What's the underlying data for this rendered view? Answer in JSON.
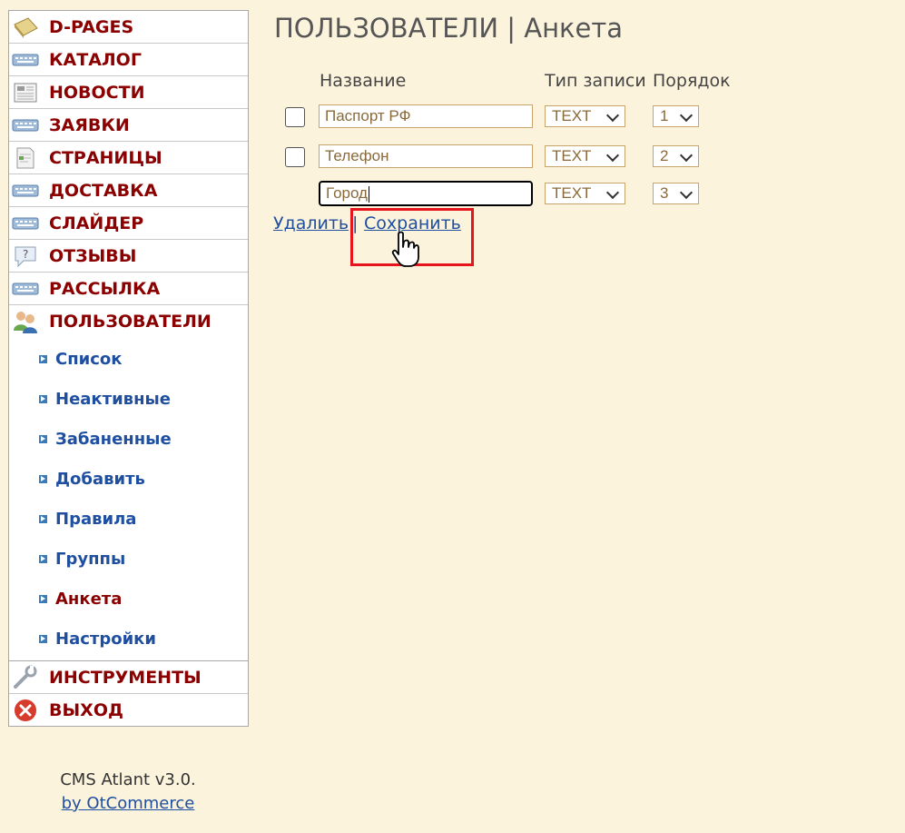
{
  "sidebar": {
    "items": [
      {
        "label": "D-PAGES",
        "icon": "book-icon"
      },
      {
        "label": "КАТАЛОГ",
        "icon": "keyboard-icon"
      },
      {
        "label": "НОВОСТИ",
        "icon": "newspaper-icon"
      },
      {
        "label": "ЗАЯВКИ",
        "icon": "keyboard-icon"
      },
      {
        "label": "СТРАНИЦЫ",
        "icon": "page-icon"
      },
      {
        "label": "ДОСТАВКА",
        "icon": "keyboard-icon"
      },
      {
        "label": "СЛАЙДЕР",
        "icon": "keyboard-icon"
      },
      {
        "label": "ОТЗЫВЫ",
        "icon": "question-bubble-icon"
      },
      {
        "label": "РАССЫЛКА",
        "icon": "keyboard-icon"
      },
      {
        "label": "ПОЛЬЗОВАТЕЛИ",
        "icon": "users-icon"
      }
    ],
    "subitems": [
      {
        "label": "Список"
      },
      {
        "label": "Неактивные"
      },
      {
        "label": "Забаненные"
      },
      {
        "label": "Добавить"
      },
      {
        "label": "Правила"
      },
      {
        "label": "Группы"
      },
      {
        "label": "Анкета",
        "active": true
      },
      {
        "label": "Настройки"
      }
    ],
    "bottom_items": [
      {
        "label": "ИНСТРУМЕНТЫ",
        "icon": "wrench-icon"
      },
      {
        "label": "ВЫХОД",
        "icon": "exit-icon"
      }
    ]
  },
  "footer": {
    "line1": "CMS Atlant v3.0.",
    "link": "by OtCommerce"
  },
  "main": {
    "title": "ПОЛЬЗОВАТЕЛИ | Анкета",
    "columns": {
      "name": "Название",
      "type": "Тип записи",
      "order": "Порядок"
    },
    "rows": [
      {
        "name": "Паспорт РФ",
        "type": "TEXT",
        "order": "1",
        "has_checkbox": true
      },
      {
        "name": "Телефон",
        "type": "TEXT",
        "order": "2",
        "has_checkbox": true
      },
      {
        "name": "Город",
        "type": "TEXT",
        "order": "3",
        "has_checkbox": false
      }
    ],
    "actions": {
      "delete": "Удалить",
      "separator": "|",
      "save": "Сохранить"
    }
  },
  "colors": {
    "background": "#fbf3dc",
    "menu_text": "#8b0000",
    "sub_text": "#1f4fa0",
    "highlight": "#e8141b"
  }
}
